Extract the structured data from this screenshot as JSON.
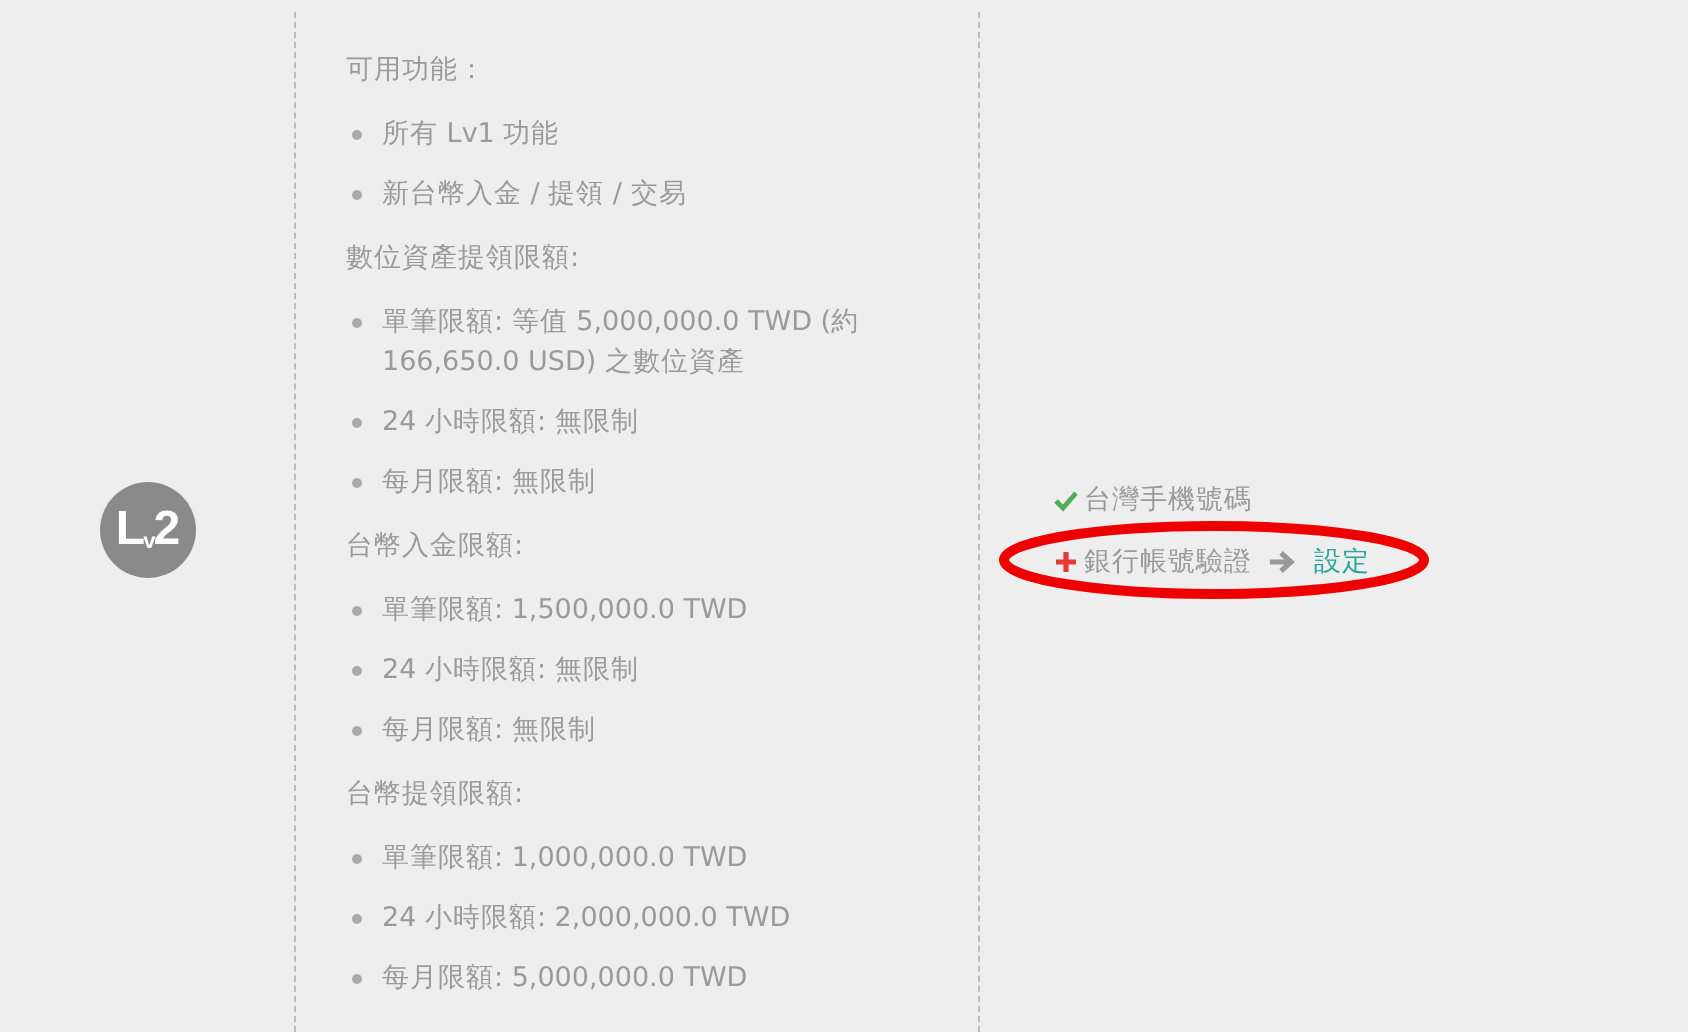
{
  "level_badge": "L$_{v}$2",
  "sections": [
    {
      "heading": "可用功能：",
      "items": [
        "所有 Lv1 功能",
        "新台幣入金 / 提領 / 交易"
      ]
    },
    {
      "heading": "數位資產提領限額:",
      "items": [
        "單筆限額: 等值 5,000,000.0 TWD (約 166,650.0 USD) 之數位資產",
        "24 小時限額: 無限制",
        "每月限額: 無限制"
      ]
    },
    {
      "heading": "台幣入金限額:",
      "items": [
        "單筆限額: 1,500,000.0 TWD",
        "24 小時限額: 無限制",
        "每月限額: 無限制"
      ]
    },
    {
      "heading": "台幣提領限額:",
      "items": [
        "單筆限額: 1,000,000.0 TWD",
        "24 小時限額: 2,000,000.0 TWD",
        "每月限額: 5,000,000.0 TWD"
      ]
    }
  ],
  "requirements": [
    {
      "label": "台灣手機號碼",
      "kind": "done"
    },
    {
      "label": "銀行帳號驗證",
      "kind": "todo",
      "action": "設定",
      "highlighted": true
    }
  ]
}
